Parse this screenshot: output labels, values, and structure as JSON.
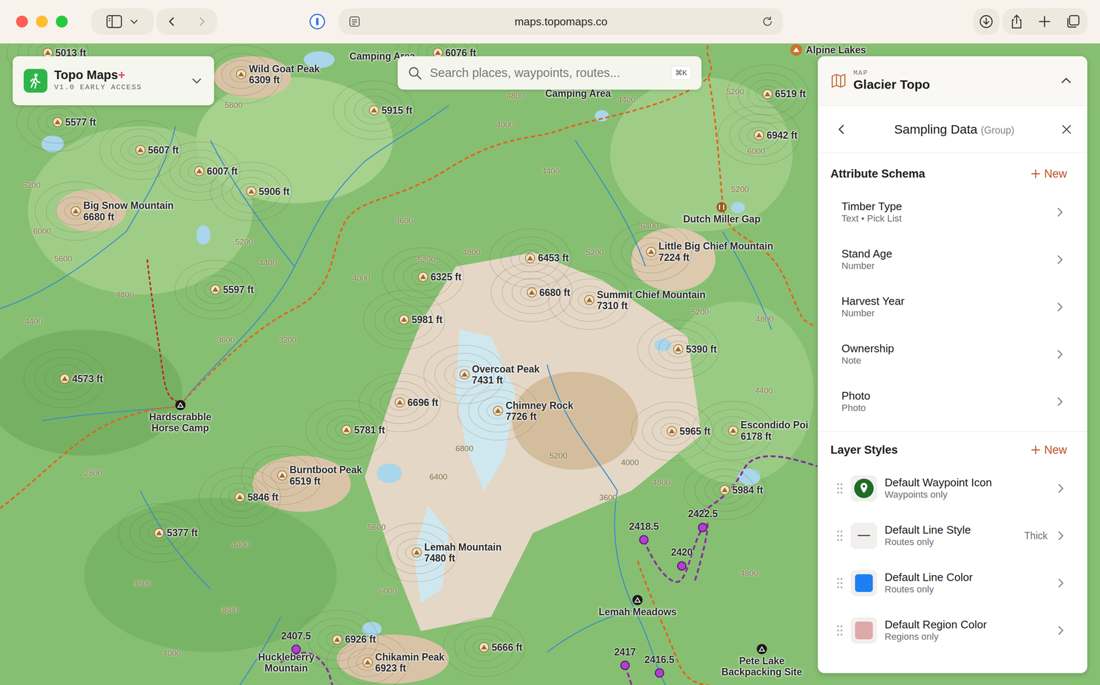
{
  "browser": {
    "url": "maps.topomaps.co",
    "back": {
      "disabled": false
    },
    "forward": {
      "disabled": true
    }
  },
  "app": {
    "name": "Topo Maps",
    "plus": "+",
    "version": "V1.0 EARLY ACCESS"
  },
  "search": {
    "placeholder": "Search places, waypoints, routes...",
    "shortcut": "⌘K"
  },
  "panel": {
    "kicker": "MAP",
    "title": "Glacier Topo",
    "expanded": true,
    "view": {
      "title": "Sampling Data",
      "subtitle": "(Group)"
    },
    "schema": {
      "title": "Attribute Schema",
      "action": "New",
      "items": [
        {
          "name": "Timber Type",
          "type": "Text • Pick List"
        },
        {
          "name": "Stand Age",
          "type": "Number"
        },
        {
          "name": "Harvest Year",
          "type": "Number"
        },
        {
          "name": "Ownership",
          "type": "Note"
        },
        {
          "name": "Photo",
          "type": "Photo"
        }
      ]
    },
    "styles": {
      "title": "Layer Styles",
      "action": "New",
      "items": [
        {
          "name": "Default Waypoint Icon",
          "scope": "Waypoints only",
          "kind": "pin"
        },
        {
          "name": "Default Line Style",
          "scope": "Routes only",
          "kind": "line",
          "value": "Thick"
        },
        {
          "name": "Default Line Color",
          "scope": "Routes only",
          "kind": "swatch",
          "color": "#1e7ff2"
        },
        {
          "name": "Default Region Color",
          "scope": "Regions only",
          "kind": "swatch",
          "color": "#dfa9ac"
        }
      ]
    }
  },
  "map": {
    "peaks": [
      {
        "elevation": "5013 ft"
      },
      {
        "name": "Wild Goat Peak",
        "elevation": "6309 ft"
      },
      {
        "elevation": "6076 ft"
      },
      {
        "elevation": "5915 ft"
      },
      {
        "elevation": "5577 ft"
      },
      {
        "elevation": "5607 ft"
      },
      {
        "elevation": "6007 ft"
      },
      {
        "elevation": "5906 ft"
      },
      {
        "name": "Big Snow Mountain",
        "elevation": "6680 ft"
      },
      {
        "elevation": "5597 ft"
      },
      {
        "elevation": "6453 ft"
      },
      {
        "elevation": "6325 ft"
      },
      {
        "elevation": "6680 ft"
      },
      {
        "name": "Summit Chief Mountain",
        "elevation": "7310 ft"
      },
      {
        "name": "Little Big Chief Mountain",
        "elevation": "7224 ft"
      },
      {
        "elevation": "5981 ft"
      },
      {
        "elevation": "5390 ft"
      },
      {
        "elevation": "4573 ft"
      },
      {
        "name": "Overcoat Peak",
        "elevation": "7431 ft"
      },
      {
        "name": "Chimney Rock",
        "elevation": "7726 ft"
      },
      {
        "elevation": "6696 ft"
      },
      {
        "elevation": "5781 ft"
      },
      {
        "elevation": "5965 ft"
      },
      {
        "name": "Escondido Poi",
        "elevation": "6178 ft"
      },
      {
        "name": "Burntboot Peak",
        "elevation": "6519 ft"
      },
      {
        "elevation": "5846 ft"
      },
      {
        "elevation": "5984 ft"
      },
      {
        "elevation": "5377 ft"
      },
      {
        "name": "Lemah Mountain",
        "elevation": "7480 ft"
      },
      {
        "elevation": "6926 ft"
      },
      {
        "elevation": "5666 ft"
      },
      {
        "name": "Chikamin Peak",
        "elevation": "6923 ft"
      },
      {
        "elevation": "6519 ft"
      },
      {
        "elevation": "6942 ft"
      }
    ],
    "places": [
      {
        "kind": "label",
        "lines": [
          "Camping Area"
        ]
      },
      {
        "kind": "label",
        "lines": [
          "Camping Area"
        ]
      },
      {
        "kind": "poi",
        "lines": [
          "Alpine Lakes"
        ]
      },
      {
        "kind": "gap",
        "lines": [
          "Dutch Miller Gap"
        ]
      },
      {
        "kind": "camp",
        "lines": [
          "Hardscrabble",
          "Horse Camp"
        ]
      },
      {
        "kind": "camp",
        "lines": [
          "Lemah Meadows"
        ]
      },
      {
        "kind": "camp",
        "lines": [
          "Pete Lake",
          "Backpacking Site"
        ]
      },
      {
        "kind": "label",
        "lines": [
          "Huckleberry",
          "Mountain"
        ]
      }
    ],
    "waypoints": [
      {
        "label": "2418.5"
      },
      {
        "label": "2422.5"
      },
      {
        "label": "2420"
      },
      {
        "label": "2417"
      },
      {
        "label": "2407.5"
      },
      {
        "label": "2416.5"
      }
    ],
    "contours": [
      "4800",
      "4000",
      "4400",
      "3600",
      "4400",
      "5600",
      "5200",
      "6000",
      "5600",
      "4800",
      "4400",
      "5200",
      "4400",
      "3600",
      "3200",
      "2800",
      "4000",
      "3600",
      "3600",
      "4000",
      "6400",
      "6800",
      "5200",
      "5600",
      "6000",
      "3600",
      "4000",
      "4800",
      "4400",
      "5200",
      "4800",
      "5200",
      "6400",
      "5200",
      "6000",
      "5200",
      "4000",
      "4800",
      "5200",
      "4800"
    ]
  }
}
